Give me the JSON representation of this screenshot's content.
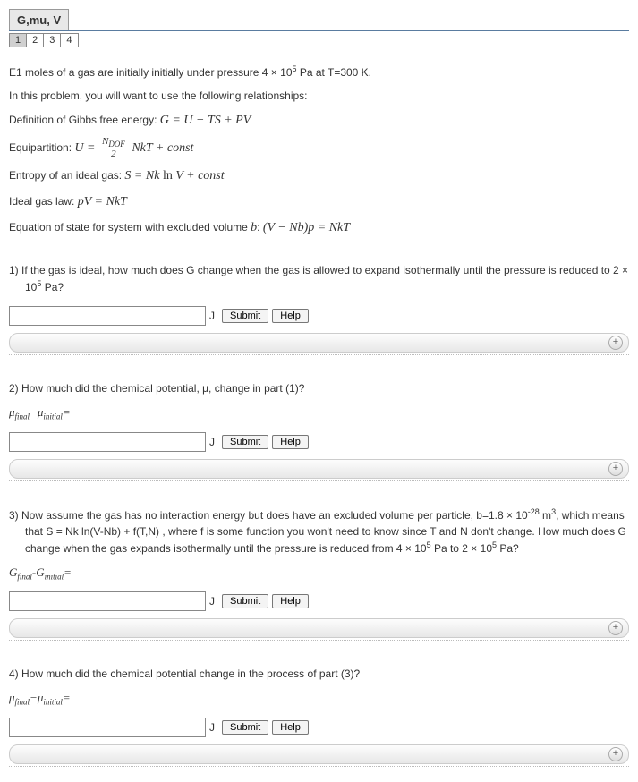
{
  "header": {
    "title": "G,mu, V",
    "tabs": [
      "1",
      "2",
      "3",
      "4"
    ],
    "active_tab": 0
  },
  "intro": {
    "line1_a": "E1 moles of a gas are initially initially under pressure 4 × 10",
    "line1_exp": "5",
    "line1_b": " Pa at T=300 K.",
    "line2": "In this problem, you will want to use the following relationships:",
    "def_gibbs_label": "Definition of Gibbs free energy: ",
    "def_gibbs_formula": "G = U − TS + PV",
    "equipartition_label": "Equipartition: ",
    "equipartition_num": "N",
    "equipartition_num_sub": "DOF",
    "equipartition_den": "2",
    "equipartition_tail": " NkT + const",
    "entropy_label": "Entropy of an ideal gas: ",
    "entropy_formula": "S = Nk ln V + const",
    "ideal_label": "Ideal gas law: ",
    "ideal_formula": "pV = NkT",
    "eos_label": "Equation of state for system with excluded volume ",
    "eos_b": "b",
    "eos_formula": "(V − Nb)p = NkT"
  },
  "questions": {
    "q1": {
      "text_a": "1) If the gas is ideal, how much does G change when the gas is allowed to expand isothermally until the pressure is reduced to 2 × 10",
      "text_exp": "5",
      "text_b": " Pa?",
      "unit": "J"
    },
    "q2": {
      "text": "2) How much did the chemical potential, μ, change in part (1)?",
      "label_html": "μ_final − μ_initial =",
      "unit": "J"
    },
    "q3": {
      "text_a": "3) Now assume the gas has no interaction energy but does have an excluded volume per particle, b=1.8 × 10",
      "text_exp1": "-28",
      "text_b": " m",
      "text_exp2": "3",
      "text_c": ", which means that S = Nk ln(V-Nb) + f(T,N) , where  f  is some function you won't need to know since T and N don't change. How much does G change when the gas expands isothermally until the pressure is reduced from 4 × 10",
      "text_exp3": "5",
      "text_d": " Pa to 2 × 10",
      "text_exp4": "5",
      "text_e": "  Pa?",
      "label": "G_final - G_initial =",
      "unit": "J"
    },
    "q4": {
      "text": "4) How much did the chemical potential change in the process of part (3)?",
      "label_html": "μ_final − μ_initial =",
      "unit": "J"
    }
  },
  "buttons": {
    "submit": "Submit",
    "help": "Help"
  }
}
